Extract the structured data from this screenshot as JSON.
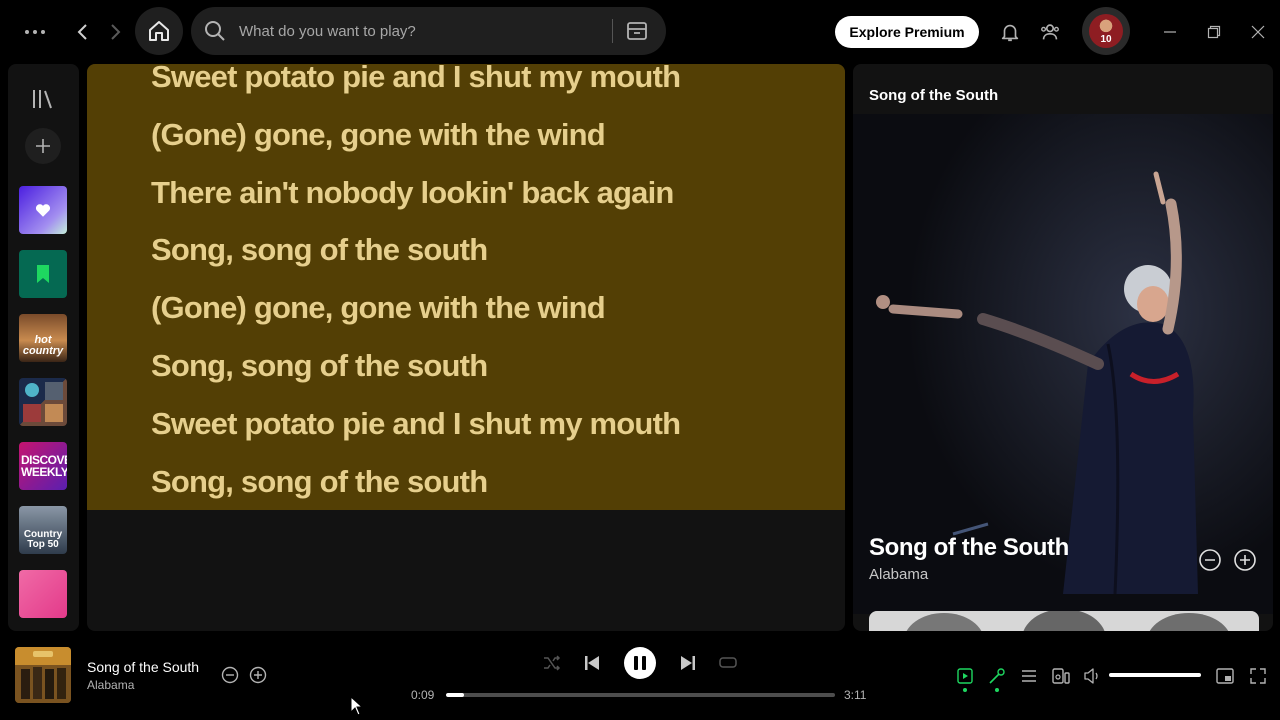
{
  "search": {
    "placeholder": "What do you want to play?"
  },
  "header": {
    "explore_label": "Explore Premium",
    "avatar_number": "10"
  },
  "sidebar": {
    "items": [
      {
        "name": "liked-songs",
        "text": ""
      },
      {
        "name": "saved-episodes",
        "text": ""
      },
      {
        "name": "hot-country",
        "text": "hot country"
      },
      {
        "name": "playlist-mix",
        "text": ""
      },
      {
        "name": "discover-weekly",
        "text": "DISCOVER WEEKLY"
      },
      {
        "name": "country-top-50",
        "text": "Country Top 50"
      },
      {
        "name": "pink-playlist",
        "text": ""
      }
    ]
  },
  "lyrics": [
    "Sweet potato pie and I shut my mouth",
    "(Gone) gone, gone with the wind",
    "There ain't nobody lookin' back again",
    "Song, song of the south",
    "(Gone) gone, gone with the wind",
    "Song, song of the south",
    "Sweet potato pie and I shut my mouth",
    "Song, song of the south"
  ],
  "now_playing_panel": {
    "header": "Song of the South",
    "title": "Song of the South",
    "artist": "Alabama"
  },
  "player": {
    "title": "Song of the South",
    "artist": "Alabama",
    "elapsed": "0:09",
    "duration": "3:11",
    "progress_fraction": 0.047,
    "volume_fraction": 1.0
  },
  "colors": {
    "accent": "#1ed760",
    "lyrics_bg": "#533f05",
    "lyrics_text": "#e6cf8d"
  }
}
